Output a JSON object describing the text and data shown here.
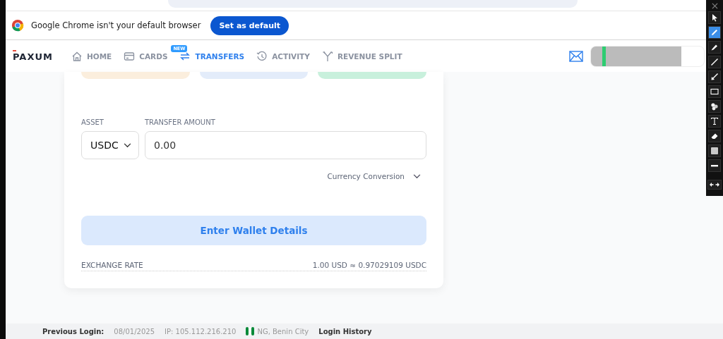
{
  "infobar": {
    "message": "Google Chrome isn't your default browser",
    "button": "Set as default"
  },
  "nav": {
    "logo": "PAXUM",
    "items": [
      {
        "label": "HOME",
        "kind": "home",
        "selected": false
      },
      {
        "label": "CARDS",
        "kind": "card",
        "selected": false,
        "badge": "NEW"
      },
      {
        "label": "TRANSFERS",
        "kind": "transfer",
        "selected": true
      },
      {
        "label": "ACTIVITY",
        "kind": "history",
        "selected": false
      },
      {
        "label": "REVENUE SPLIT",
        "kind": "split",
        "selected": false
      }
    ]
  },
  "form": {
    "asset_label": "ASSET",
    "asset_value": "USDC",
    "amount_label": "TRANSFER AMOUNT",
    "amount_value": "0.00",
    "conversion": "Currency Conversion",
    "submit": "Enter Wallet Details",
    "rate_label": "EXCHANGE RATE",
    "rate_value": "1.00 USD ≈ 0.97029109 USDC"
  },
  "footer": {
    "label": "Previous Login:",
    "date": "08/01/2025",
    "ip": "IP: 105.112.216.210",
    "location": "NG, Benin City",
    "link": "Login History"
  },
  "tools": [
    {
      "kind": "pointer",
      "selected": false
    },
    {
      "kind": "pencil",
      "selected": true
    },
    {
      "kind": "marker",
      "selected": false
    },
    {
      "kind": "line",
      "selected": false
    },
    {
      "kind": "arrow",
      "selected": false
    },
    {
      "kind": "rectangle",
      "selected": false
    },
    {
      "kind": "stamp",
      "selected": false
    },
    {
      "kind": "text",
      "selected": false
    },
    {
      "kind": "eraser",
      "selected": false
    },
    {
      "kind": "fill",
      "selected": false
    },
    {
      "kind": "stroke",
      "selected": false
    }
  ]
}
